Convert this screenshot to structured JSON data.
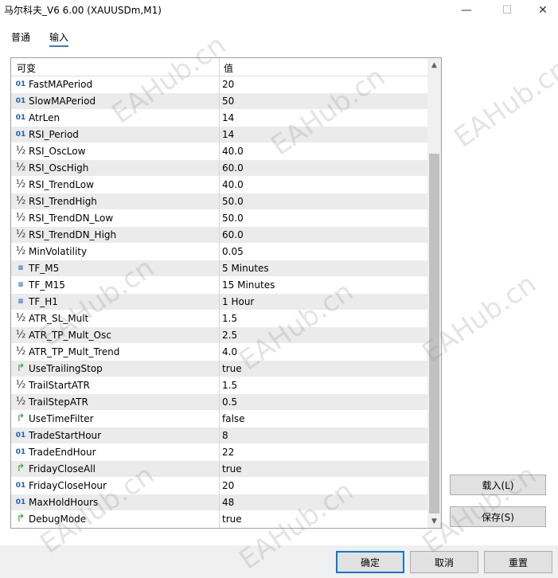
{
  "window": {
    "title": "马尔科夫_V6 6.00 (XAUUSDm,M1)",
    "minimize_icon": "—",
    "maximize_icon": "☐",
    "close_icon": "✕"
  },
  "tabs": [
    {
      "label": "普通",
      "active": false
    },
    {
      "label": "输入",
      "active": true
    }
  ],
  "table": {
    "columns": [
      "可变",
      "值"
    ],
    "rows": [
      {
        "type": "int",
        "icon": "01",
        "name": "FastMAPeriod",
        "value": "20"
      },
      {
        "type": "int",
        "icon": "01",
        "name": "SlowMAPeriod",
        "value": "50"
      },
      {
        "type": "int",
        "icon": "01",
        "name": "AtrLen",
        "value": "14"
      },
      {
        "type": "int",
        "icon": "01",
        "name": "RSI_Period",
        "value": "14"
      },
      {
        "type": "double",
        "icon": "½",
        "name": "RSI_OscLow",
        "value": "40.0"
      },
      {
        "type": "double",
        "icon": "½",
        "name": "RSI_OscHigh",
        "value": "60.0"
      },
      {
        "type": "double",
        "icon": "½",
        "name": "RSI_TrendLow",
        "value": "40.0"
      },
      {
        "type": "double",
        "icon": "½",
        "name": "RSI_TrendHigh",
        "value": "50.0"
      },
      {
        "type": "double",
        "icon": "½",
        "name": "RSI_TrendDN_Low",
        "value": "50.0"
      },
      {
        "type": "double",
        "icon": "½",
        "name": "RSI_TrendDN_High",
        "value": "60.0"
      },
      {
        "type": "double",
        "icon": "½",
        "name": "MinVolatility",
        "value": "0.05"
      },
      {
        "type": "enum",
        "icon": "≡",
        "name": "TF_M5",
        "value": "5 Minutes"
      },
      {
        "type": "enum",
        "icon": "≡",
        "name": "TF_M15",
        "value": "15 Minutes"
      },
      {
        "type": "enum",
        "icon": "≡",
        "name": "TF_H1",
        "value": "1 Hour"
      },
      {
        "type": "double",
        "icon": "½",
        "name": "ATR_SL_Mult",
        "value": "1.5"
      },
      {
        "type": "double",
        "icon": "½",
        "name": "ATR_TP_Mult_Osc",
        "value": "2.5"
      },
      {
        "type": "double",
        "icon": "½",
        "name": "ATR_TP_Mult_Trend",
        "value": "4.0"
      },
      {
        "type": "bool",
        "icon": "↱",
        "name": "UseTrailingStop",
        "value": "true"
      },
      {
        "type": "double",
        "icon": "½",
        "name": "TrailStartATR",
        "value": "1.5"
      },
      {
        "type": "double",
        "icon": "½",
        "name": "TrailStepATR",
        "value": "0.5"
      },
      {
        "type": "bool",
        "icon": "↱",
        "name": "UseTimeFilter",
        "value": "false"
      },
      {
        "type": "int",
        "icon": "01",
        "name": "TradeStartHour",
        "value": "8"
      },
      {
        "type": "int",
        "icon": "01",
        "name": "TradeEndHour",
        "value": "22"
      },
      {
        "type": "bool",
        "icon": "↱",
        "name": "FridayCloseAll",
        "value": "true"
      },
      {
        "type": "int",
        "icon": "01",
        "name": "FridayCloseHour",
        "value": "20"
      },
      {
        "type": "int",
        "icon": "01",
        "name": "MaxHoldHours",
        "value": "48"
      },
      {
        "type": "bool",
        "icon": "↱",
        "name": "DebugMode",
        "value": "true"
      }
    ]
  },
  "side_buttons": {
    "load": "载入(L)",
    "save": "保存(S)"
  },
  "footer_buttons": {
    "ok": "确定",
    "cancel": "取消",
    "reset": "重置"
  },
  "watermark": "EAHub.cn",
  "colors": {
    "accent": "#0078d7",
    "int_icon": "#1a5fb4",
    "bool_icon": "#2e9e3e",
    "stripe": "#ebebeb"
  }
}
